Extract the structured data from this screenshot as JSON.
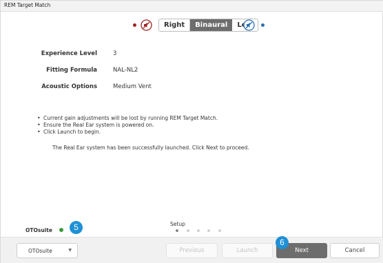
{
  "window": {
    "title": "REM Target Match"
  },
  "ear_selector": {
    "options": [
      "Right",
      "Binaural",
      "Left"
    ],
    "selected": "Binaural",
    "right_color": "#a02020",
    "left_color": "#2a6fb5",
    "right_icon": "muted-speaker-icon",
    "left_icon": "connected-probe-icon"
  },
  "info": {
    "rows": [
      {
        "label": "Experience Level",
        "value": "3"
      },
      {
        "label": "Fitting Formula",
        "value": "NAL-NL2"
      },
      {
        "label": "Acoustic Options",
        "value": "Medium Vent"
      }
    ]
  },
  "instructions": {
    "bullets": [
      "Current gain adjustments will be lost by running REM Target Match.",
      "Ensure the Real Ear system is powered on.",
      "Click Launch to begin."
    ],
    "status_message": "The Real Ear system has been successfully launched. Click Next to proceed."
  },
  "status": {
    "oto_label": "OTOsuite",
    "oto_color": "#3a9a3a",
    "setup_label": "Setup",
    "steps_total": 5,
    "current_step": 1
  },
  "badges": {
    "oto": "5",
    "next": "6"
  },
  "footer": {
    "dropdown_value": "OTOsuite",
    "previous_label": "Previous",
    "launch_label": "Launch",
    "next_label": "Next",
    "cancel_label": "Cancel"
  }
}
